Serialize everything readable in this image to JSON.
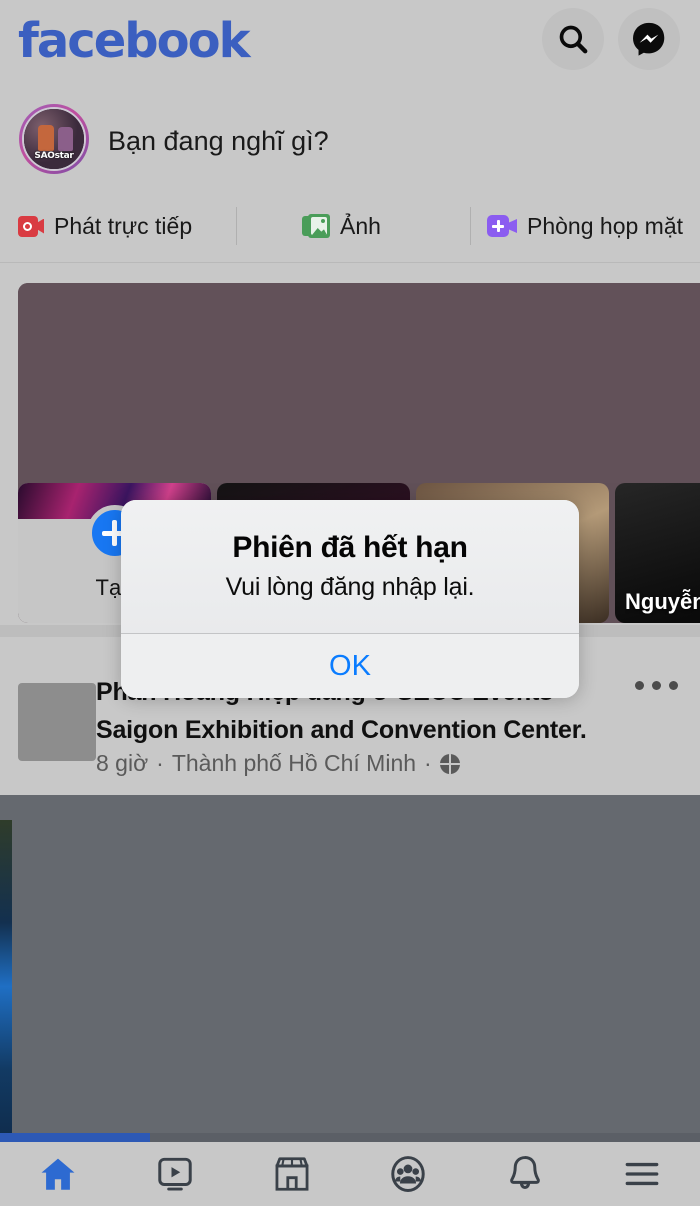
{
  "header": {
    "logo_text": "facebook",
    "logo_color": "#3b5fc0",
    "search_icon": "search-icon",
    "messenger_icon": "messenger-icon"
  },
  "composer": {
    "placeholder": "Bạn đang nghĩ gì?",
    "avatar_label": "SAOstar"
  },
  "actions": [
    {
      "label": "Phát trực tiếp",
      "icon": "live-video-icon",
      "color": "#d93b42"
    },
    {
      "label": "Ảnh",
      "icon": "photo-icon",
      "color": "#4a9d59"
    },
    {
      "label": "Phòng họp mặt",
      "icon": "video-room-icon",
      "color": "#8b5cf0"
    }
  ],
  "stories": [
    {
      "label": "Tạo",
      "type": "create"
    },
    {
      "label": "",
      "type": "photo"
    },
    {
      "label": "",
      "type": "photo"
    },
    {
      "label": "Nguyễn",
      "type": "photo"
    }
  ],
  "post": {
    "title_line1": "Phan Hoàng Hiệp đang ở SECC Events -",
    "title_line2": "Saigon Exhibition and Convention Center.",
    "time": "8 giờ",
    "location": "Thành phố Hồ Chí Minh",
    "privacy_icon": "globe-icon",
    "more_icon": "more-options-icon"
  },
  "dialog": {
    "title": "Phiên đã hết hạn",
    "message": "Vui lòng đăng nhập lại.",
    "ok_label": "OK",
    "ok_color": "#0a7cff"
  },
  "bottom_nav": [
    {
      "icon": "home-icon",
      "active": true
    },
    {
      "icon": "watch-video-icon",
      "active": false
    },
    {
      "icon": "marketplace-icon",
      "active": false
    },
    {
      "icon": "groups-icon",
      "active": false
    },
    {
      "icon": "notifications-bell-icon",
      "active": false
    },
    {
      "icon": "menu-hamburger-icon",
      "active": false
    }
  ]
}
